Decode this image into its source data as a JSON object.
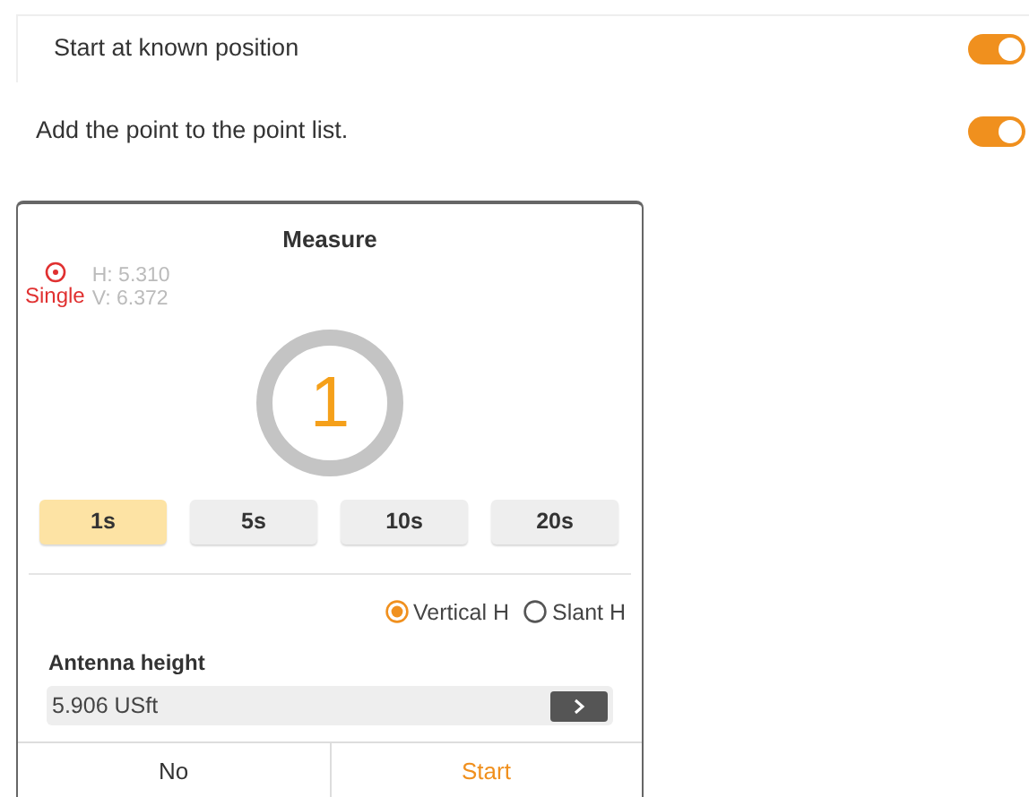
{
  "settings": [
    {
      "label": "Start at known position",
      "on": true
    },
    {
      "label": "Add the point to the point list.",
      "on": true
    }
  ],
  "dialog": {
    "title": "Measure",
    "mode": "Single",
    "h": "H: 5.310",
    "v": "V: 6.372",
    "count": "1",
    "durations": [
      {
        "label": "1s",
        "selected": true
      },
      {
        "label": "5s",
        "selected": false
      },
      {
        "label": "10s",
        "selected": false
      },
      {
        "label": "20s",
        "selected": false
      }
    ],
    "height_types": [
      {
        "label": "Vertical H",
        "selected": true
      },
      {
        "label": "Slant H",
        "selected": false
      }
    ],
    "antenna_label": "Antenna height",
    "antenna_value": "5.906 USft",
    "buttons": [
      {
        "label": "No",
        "kind": "cancel"
      },
      {
        "label": "Start",
        "kind": "confirm"
      }
    ]
  }
}
